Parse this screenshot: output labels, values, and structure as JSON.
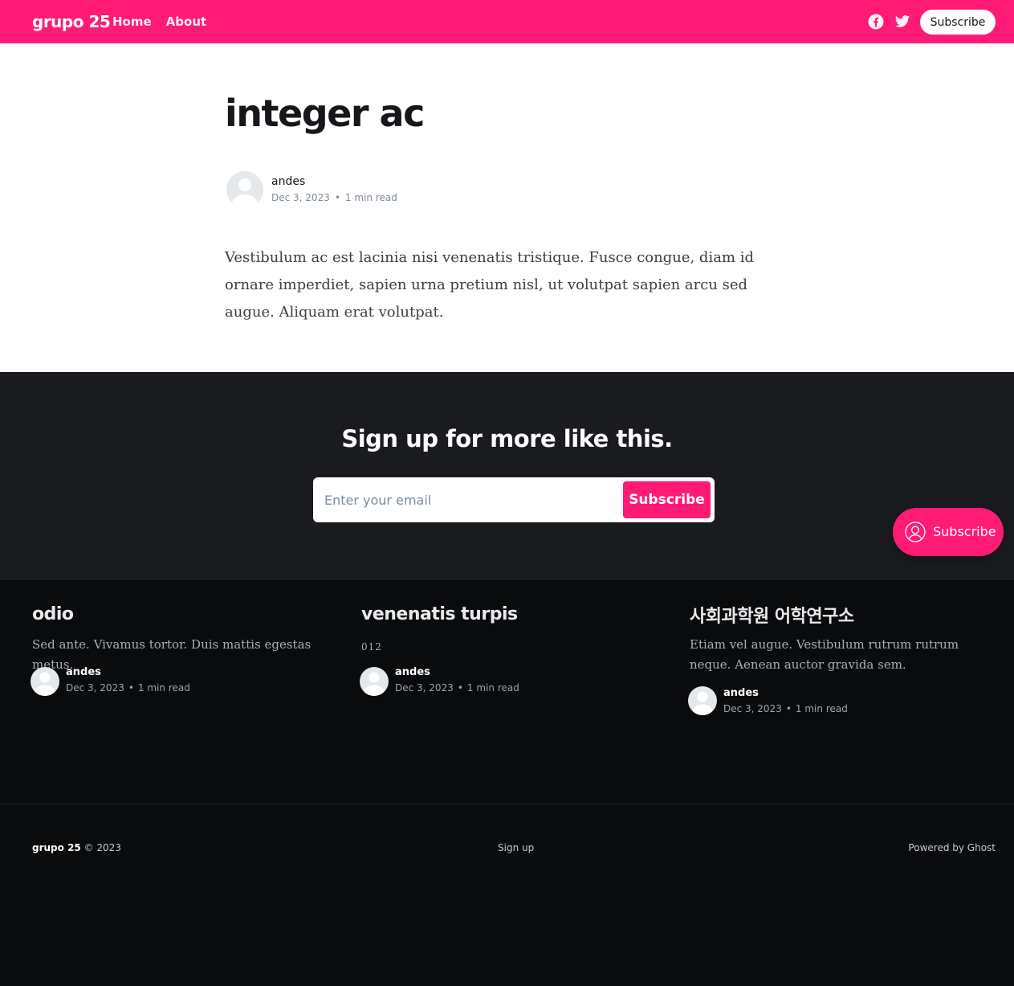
{
  "colors": {
    "accent": "#ff1a75",
    "dark": "#191b1f",
    "darker": "#0a0b0d"
  },
  "header": {
    "logo": "grupo 25",
    "nav": [
      "Home",
      "About"
    ],
    "social_icons": [
      "facebook-icon",
      "twitter-icon"
    ],
    "subscribe_label": "Subscribe"
  },
  "article": {
    "title": "integer ac",
    "author": "andes",
    "date": "Dec 3, 2023",
    "read_time": "1 min read",
    "body": "Vestibulum ac est lacinia nisi venenatis tristique. Fusce congue, diam id ornare imperdiet, sapien urna pretium nisl, ut volutpat sapien arcu sed augue. Aliquam erat volutpat."
  },
  "signup": {
    "title": "Sign up for more like this.",
    "placeholder": "Enter your email",
    "button": "Subscribe"
  },
  "portal": {
    "label": "Subscribe",
    "icon": "user-circle-icon"
  },
  "feed": [
    {
      "title": "odio",
      "excerpt": "Sed ante. Vivamus tortor. Duis mattis egestas metus.",
      "author": "andes",
      "date": "Dec 3, 2023",
      "read_time": "1 min read"
    },
    {
      "title": "venenatis turpis",
      "excerpt": "012",
      "author": "andes",
      "date": "Dec 3, 2023",
      "read_time": "1 min read"
    },
    {
      "title": "사회과학원 어학연구소",
      "excerpt": "Etiam vel augue. Vestibulum rutrum rutrum neque. Aenean auctor gravida sem.",
      "author": "andes",
      "date": "Dec 3, 2023",
      "read_time": "1 min read"
    }
  ],
  "footer": {
    "site": "grupo 25",
    "copyright": "© 2023",
    "signup_link": "Sign up",
    "powered": "Powered by Ghost"
  }
}
